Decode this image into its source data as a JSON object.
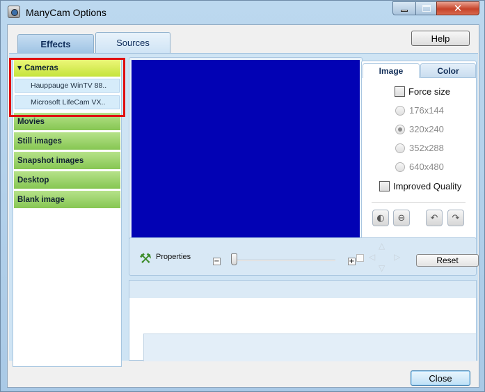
{
  "window": {
    "title": "ManyCam Options"
  },
  "tabs": [
    {
      "label": "Effects",
      "active": false
    },
    {
      "label": "Sources",
      "active": true
    }
  ],
  "help_label": "Help",
  "sources": {
    "categories": [
      {
        "label": "Cameras",
        "expanded": true,
        "items": [
          "Hauppauge WinTV 88..",
          "Microsoft LifeCam VX.."
        ]
      },
      {
        "label": "Movies"
      },
      {
        "label": "Still images"
      },
      {
        "label": "Snapshot images"
      },
      {
        "label": "Desktop"
      },
      {
        "label": "Blank image"
      }
    ]
  },
  "preview": {
    "color": "#0202b4"
  },
  "image_panel": {
    "tabs": [
      "Image",
      "Color"
    ],
    "force_size_label": "Force size",
    "force_size_checked": false,
    "sizes": [
      "176x144",
      "320x240",
      "352x288",
      "640x480"
    ],
    "selected_size": "320x240",
    "improved_quality_label": "Improved Quality",
    "improved_quality_checked": false
  },
  "properties": {
    "label": "Properties",
    "reset_label": "Reset",
    "zoom_level": 0
  },
  "close_label": "Close",
  "colors": {
    "accent_red": "#e01010",
    "category_green": "#86c652",
    "category_open": "#c5e33c"
  }
}
